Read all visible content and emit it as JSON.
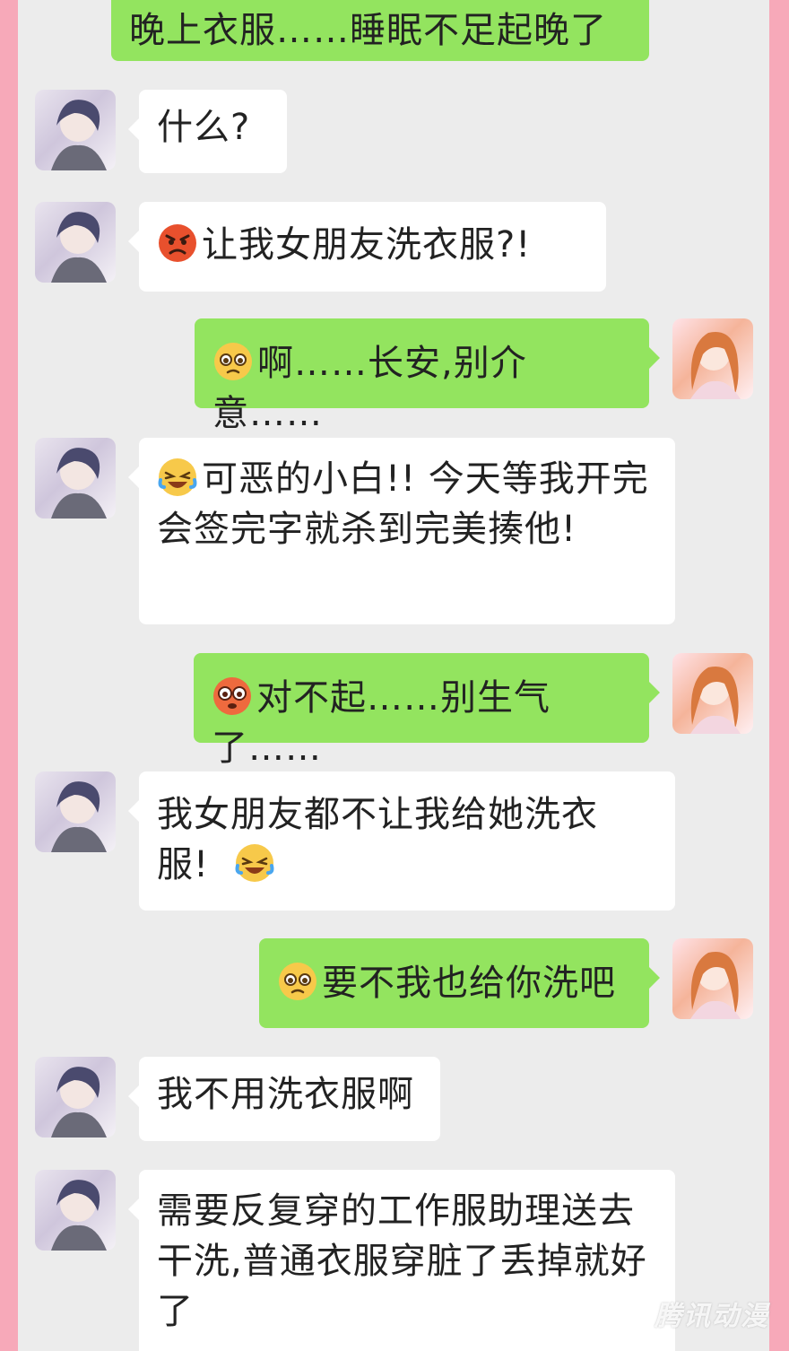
{
  "messages": [
    {
      "side": "right",
      "text": "晚上衣服……睡眠不足起晚了"
    },
    {
      "side": "left",
      "text": "什么?"
    },
    {
      "side": "left",
      "emoji": "angry-face",
      "text": "让我女朋友洗衣服?!"
    },
    {
      "side": "right",
      "emoji": "pleading-face",
      "text": "啊……长安,别介意……"
    },
    {
      "side": "left",
      "emoji": "crying-laughing-face",
      "text": "可恶的小白!! 今天等我开完会签完字就杀到完美揍他!"
    },
    {
      "side": "right",
      "emoji": "flushed-face",
      "text": "对不起……别生气了……"
    },
    {
      "side": "left",
      "text": "我女朋友都不让我给她洗衣服!",
      "emoji_after": "crying-laughing-face"
    },
    {
      "side": "right",
      "emoji": "pleading-face",
      "text": "要不我也给你洗吧"
    },
    {
      "side": "left",
      "text": "我不用洗衣服啊"
    },
    {
      "side": "left",
      "text": "需要反复穿的工作服助理送去干洗,普通衣服穿脏了丢掉就好了"
    }
  ],
  "watermark": "腾讯动漫",
  "colors": {
    "background": "#f7a9b9",
    "panel": "#ececec",
    "green_bubble": "#93e45f",
    "white_bubble": "#ffffff"
  }
}
